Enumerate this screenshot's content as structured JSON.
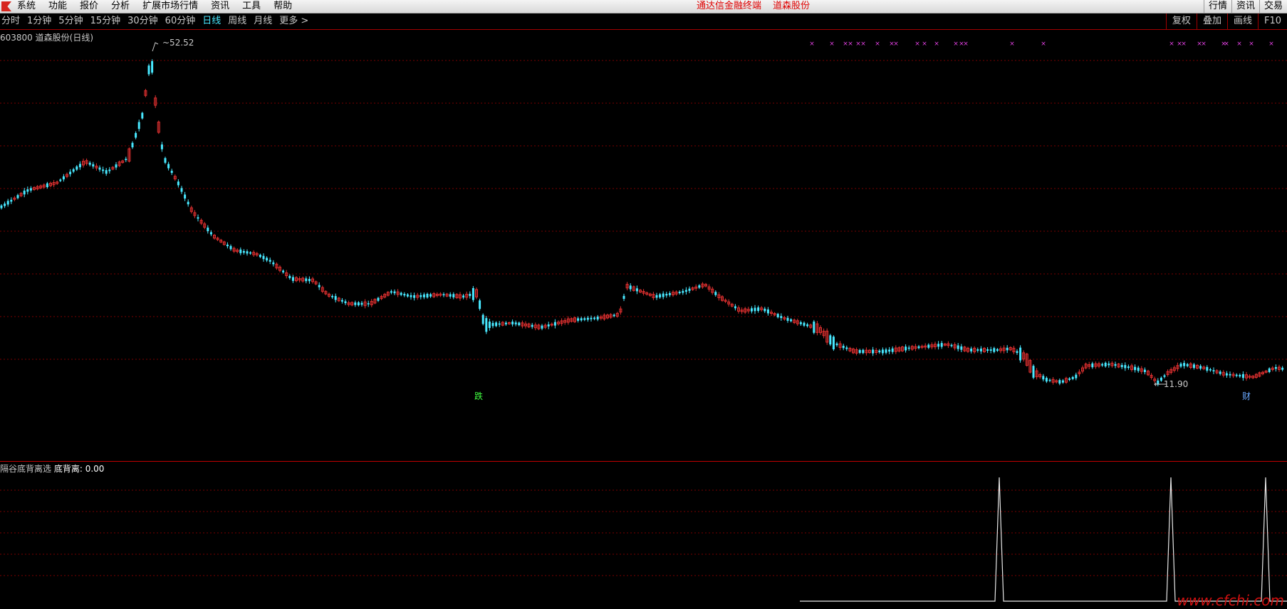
{
  "menu": {
    "items": [
      "系统",
      "功能",
      "报价",
      "分析",
      "扩展市场行情",
      "资讯",
      "工具",
      "帮助"
    ],
    "brand_1": "通达信金融终端",
    "brand_2": "道森股份",
    "right_buttons": [
      "行情",
      "资讯",
      "交易"
    ]
  },
  "periods": {
    "items": [
      "分时",
      "1分钟",
      "5分钟",
      "15分钟",
      "30分钟",
      "60分钟",
      "日线",
      "周线",
      "月线",
      "更多 >"
    ],
    "active": "日线"
  },
  "tools": [
    "复权",
    "叠加",
    "画线",
    "F10"
  ],
  "chart": {
    "code": "603800",
    "name": "道森股份",
    "period_label": "(日线)",
    "high_label": "52.52",
    "low_label": "11.90",
    "marker_1": "跌",
    "marker_2": "财",
    "up_color": "#e03030",
    "down_color": "#48e8ff"
  },
  "indicator": {
    "name": "隔谷底背离选",
    "label": "底背离",
    "value": ": 0.00"
  },
  "watermark": "www.cfchi.com"
}
